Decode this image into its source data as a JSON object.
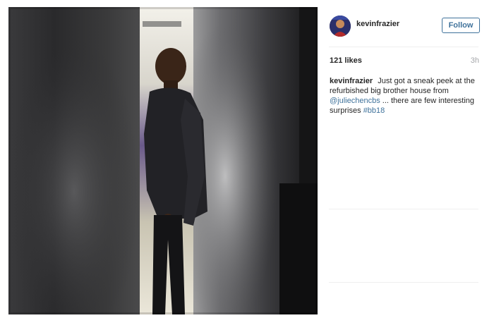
{
  "post": {
    "username": "kevinfrazier",
    "follow_label": "Follow",
    "likes": "121 likes",
    "time": "3h",
    "caption": {
      "username": "kevinfrazier",
      "text_1": "Just got a sneak peek at the refurbished big brother house from",
      "mention": "@juliechencbs",
      "text_2": "... there are few interesting surprises",
      "hashtag": "#bb18"
    }
  },
  "colors": {
    "link": "#3f729b",
    "text": "#262626",
    "muted": "#a5a7aa",
    "divider": "#efefef"
  }
}
